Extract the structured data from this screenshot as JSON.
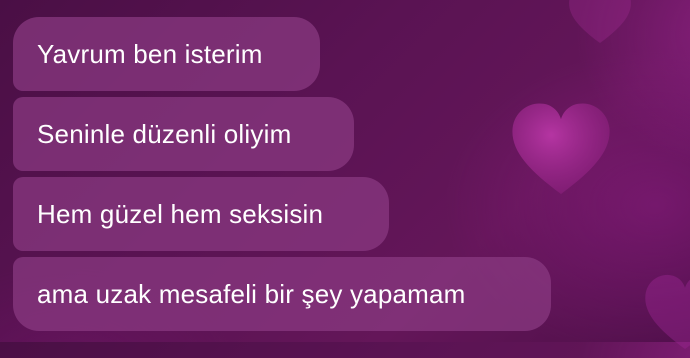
{
  "chat": {
    "messages": [
      {
        "text": "Yavrum ben isterim"
      },
      {
        "text": "Seninle düzenli oliyim"
      },
      {
        "text": "Hem güzel hem seksisin"
      },
      {
        "text": "ama uzak mesafeli bir şey yapamam"
      }
    ]
  },
  "theme": {
    "background": "#5a1353",
    "bubble_color": "#8a3a82",
    "heart_color": "#b02a9c",
    "text_color": "#ffffff"
  },
  "icons": [
    "heart-icon"
  ]
}
